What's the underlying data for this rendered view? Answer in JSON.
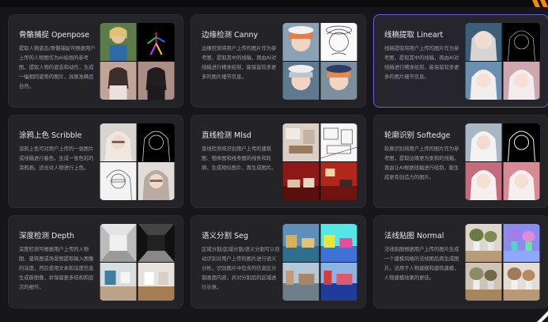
{
  "colors": {
    "background": "#17171b",
    "card": "#242428",
    "selected_border": "#6d5fd6",
    "title": "#e9e9ee",
    "desc": "#9c9ca6"
  },
  "cards": [
    {
      "title": "骨骼捕捉 Openpose",
      "desc": "提取人物姿态/骨骼捕捉可根据用户上传的人物图作为AI绘画的参考图，提取人物的姿态和动作，生成一幅相同姿势的图片，效果准确且自然。",
      "thumb_icon": "openpose-preview-image"
    },
    {
      "title": "边缘检测 Canny",
      "desc": "边缘检测将用户上传的图片作为参考图，提取其中的线稿，再由AI对线稿进行精准绘制，能保留较多更多的图片细节信息。",
      "thumb_icon": "canny-preview-image"
    },
    {
      "title": "线稿提取 Lineart",
      "desc": "线稿提取将用户上传的图片作为参考图，提取其中的线稿，再由AI对线稿进行精准绘制，能保留较多更多的图片细节信息。",
      "thumb_icon": "lineart-preview-image"
    },
    {
      "title": "涂鸦上色 Scribble",
      "desc": "涂鸦上色可对用户上传的一张图片或线稿进行着色，生成一张色彩的涂鸦画。适合对人物进行上色。",
      "thumb_icon": "scribble-preview-image"
    },
    {
      "title": "直线检测 Mlsd",
      "desc": "直线检测将识别用户上传的建筑图、物体图和线条图的线条和轮廓，生成相似图片，再生成图片。",
      "thumb_icon": "mlsd-preview-image"
    },
    {
      "title": "轮廓识别 Softedge",
      "desc": "轮廓识别将用户上传的图片作为参考图，提取边缘更为柔和的线稿，再由让AI根据线稿进行绘制，能生成更有创造力的图片。",
      "thumb_icon": "softedge-preview-image"
    },
    {
      "title": "深度检测 Depth",
      "desc": "深度检测可根据用户上传的人物图、建筑图或场景图提取输入图像的深度，然后使用文本和深度信息生成新图像，并保留更多结构和层次的细节。",
      "thumb_icon": "depth-preview-image"
    },
    {
      "title": "语义分割 Seg",
      "desc": "区域分割/区域分割/语义分割可以自动识别对用户上传的图片进行语义分析，识别图片中包含的信息区分割画面内容，并对分割后的区域进行示意。",
      "thumb_icon": "seg-preview-image"
    },
    {
      "title": "法线贴图 Normal",
      "desc": "法线贴图根据用户上传的图片生成一个建模风格的法线图后再生成图片。适用于人物建模和建筑建模，人物建模效果的更佳。",
      "thumb_icon": "normal-preview-image"
    }
  ]
}
